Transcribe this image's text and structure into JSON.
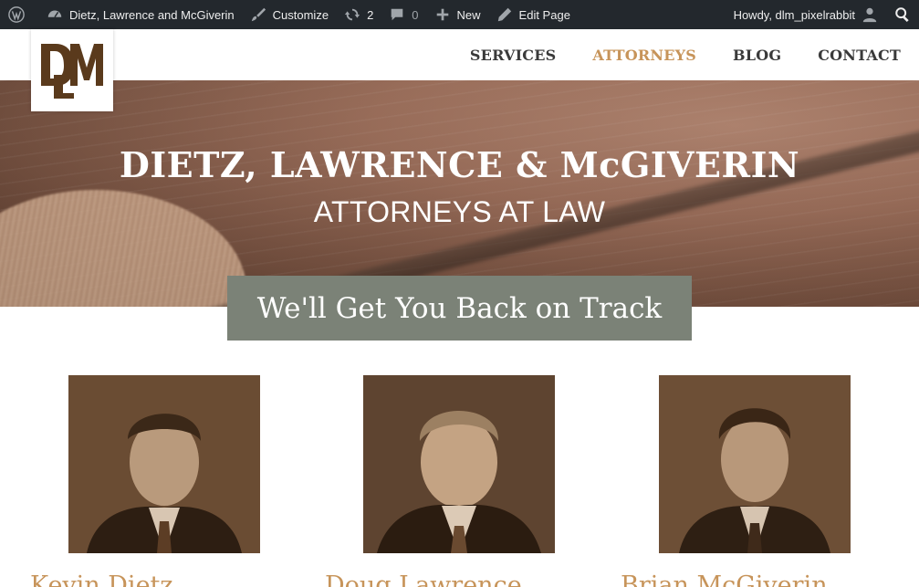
{
  "adminbar": {
    "site_name": "Dietz, Lawrence and McGiverin",
    "customize": "Customize",
    "updates_count": "2",
    "comments_count": "0",
    "new_label": "New",
    "edit_label": "Edit Page",
    "howdy": "Howdy, dlm_pixelrabbit"
  },
  "nav": {
    "items": [
      {
        "label": "SERVICES"
      },
      {
        "label": "ATTORNEYS"
      },
      {
        "label": "BLOG"
      },
      {
        "label": "CONTACT"
      }
    ],
    "active_color": "#c7945a"
  },
  "hero": {
    "title": "DIETZ, LAWRENCE & McGIVERIN",
    "subtitle": "ATTORNEYS AT LAW"
  },
  "tagline": "We'll Get You Back on Track",
  "attorneys": [
    {
      "name": "Kevin Dietz"
    },
    {
      "name": "Doug Lawrence"
    },
    {
      "name": "Brian McGiverin"
    }
  ],
  "colors": {
    "accent": "#c7945a",
    "tagline_bg": "#7b8277",
    "adminbar_bg": "#23282d",
    "portrait_tint": "#6b4e35"
  }
}
